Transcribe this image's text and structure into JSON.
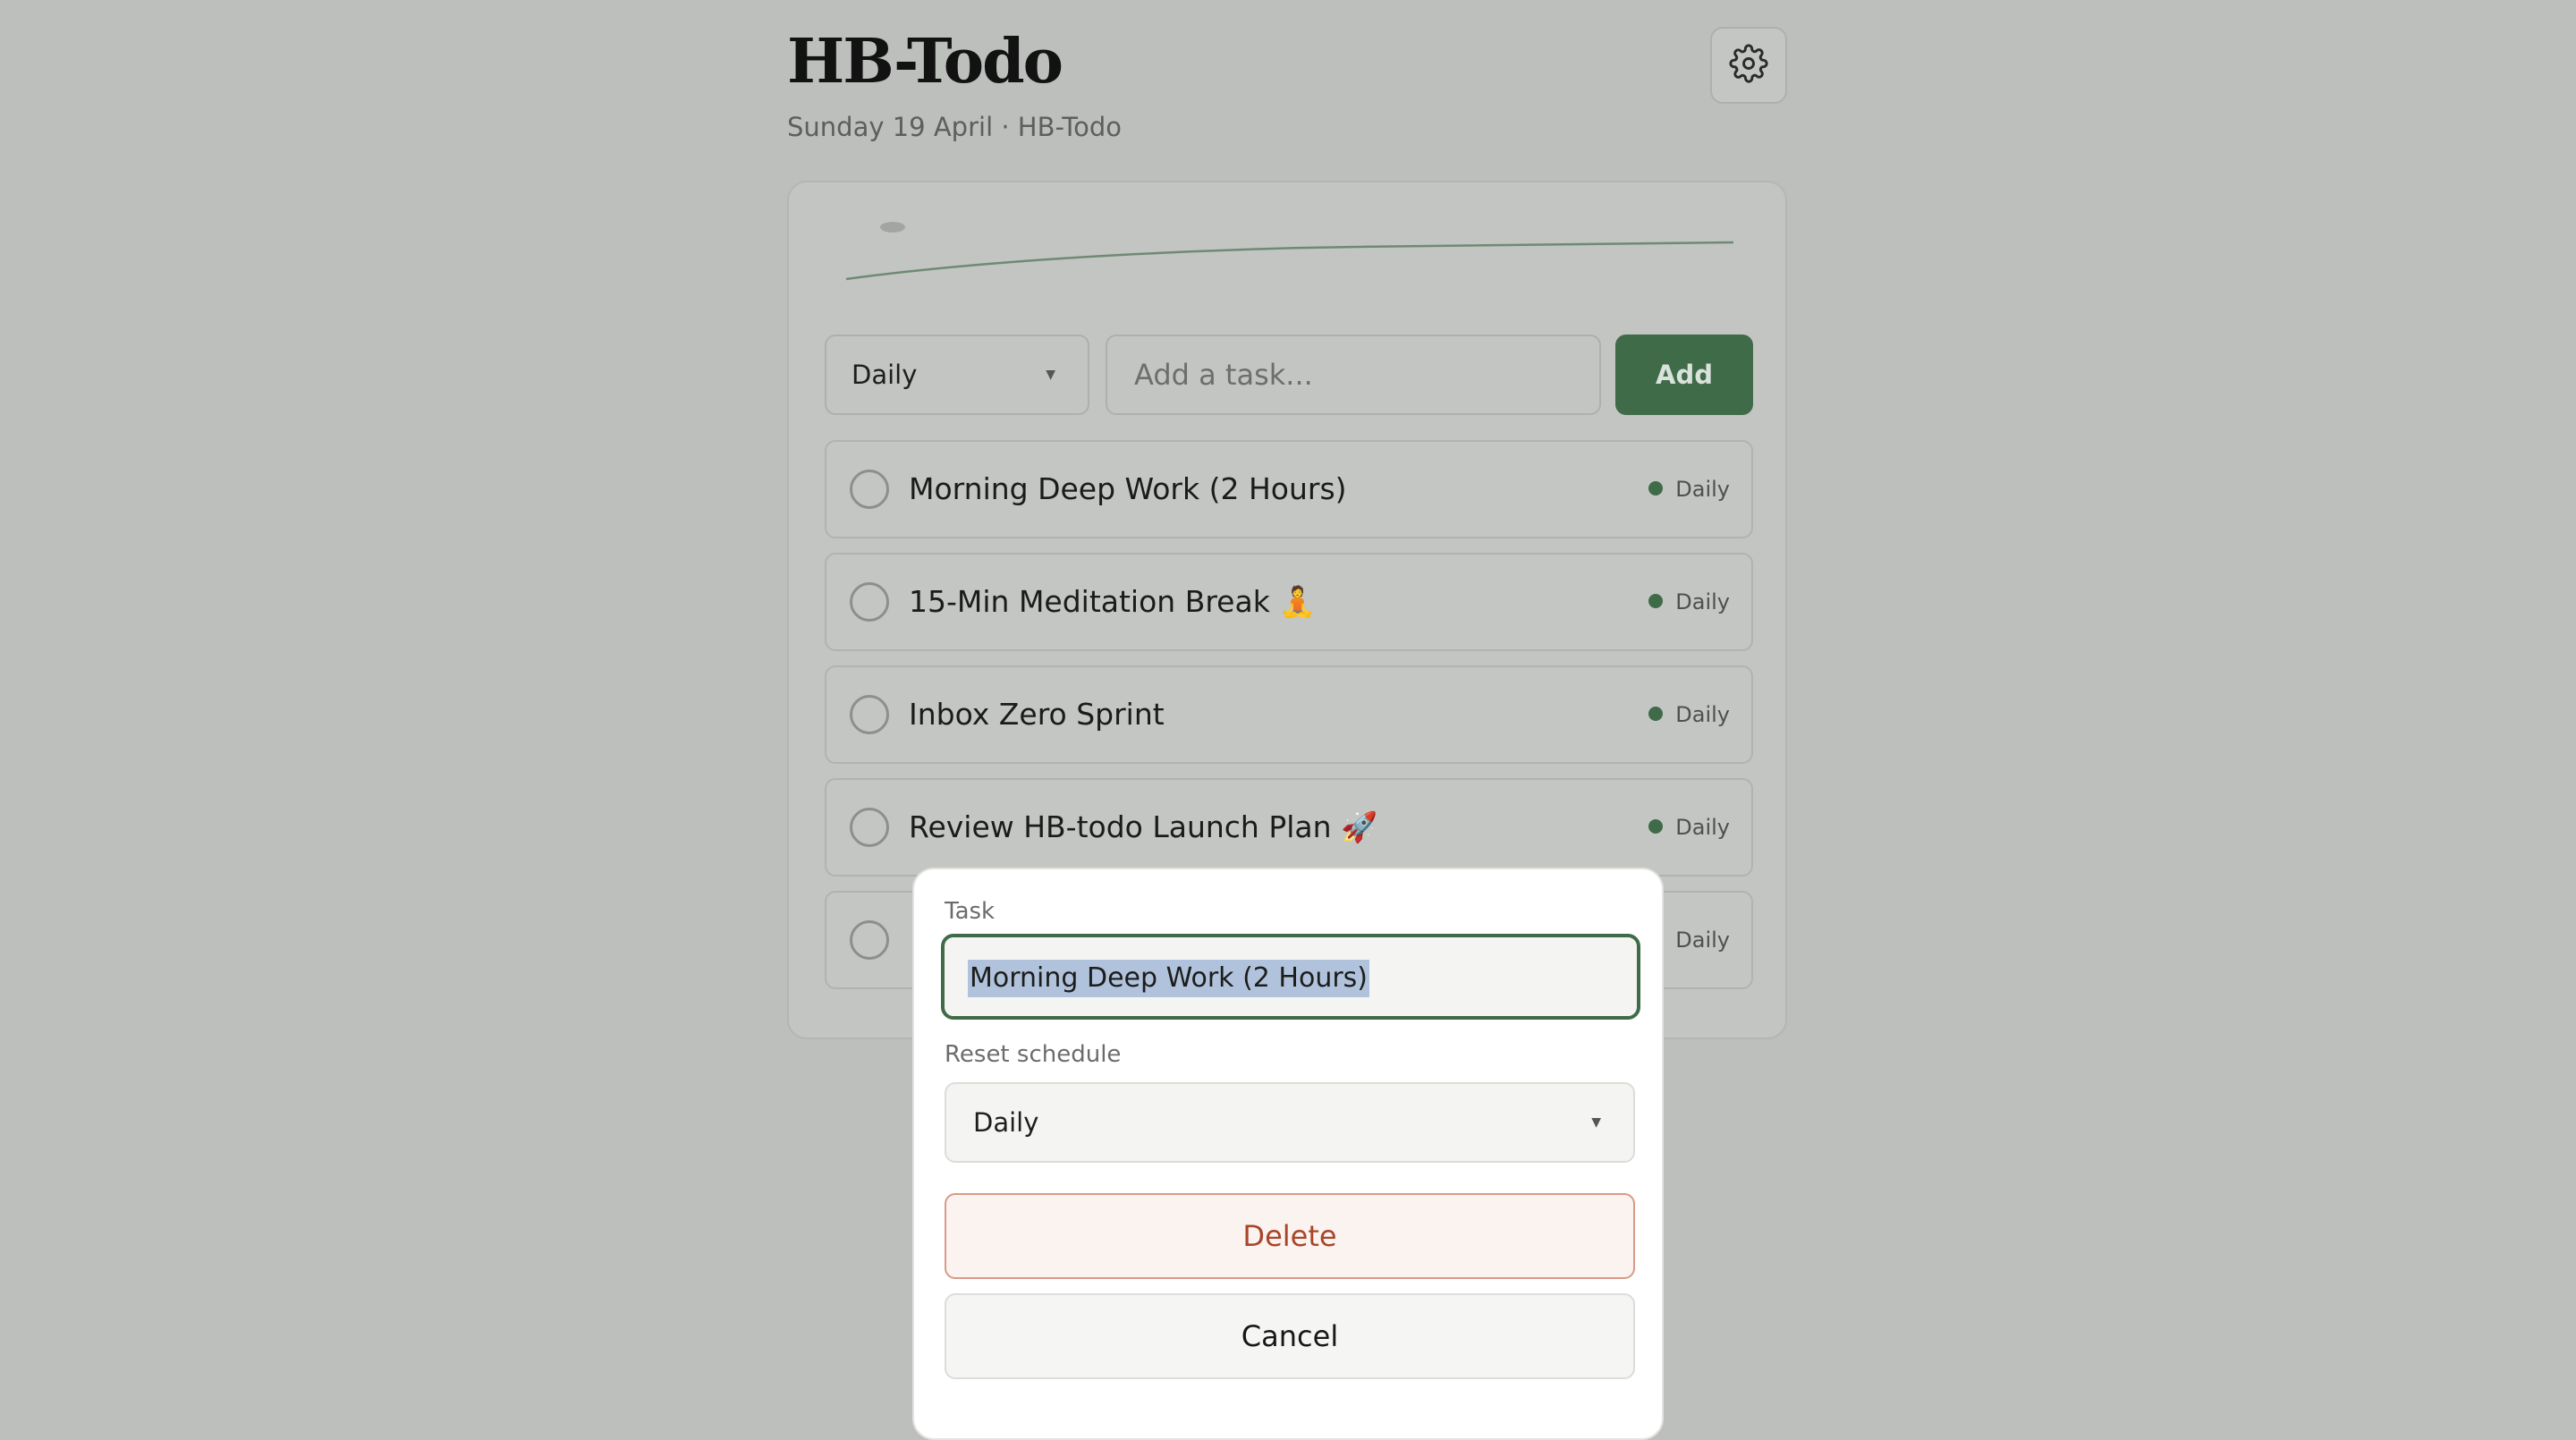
{
  "app": {
    "title": "HB-Todo",
    "subtitle": "Sunday 19 April · HB-Todo",
    "settings_icon": "gear-icon"
  },
  "composer": {
    "schedule_value": "Daily",
    "task_placeholder": "Add a task...",
    "add_label": "Add"
  },
  "tasks": [
    {
      "text": "Morning Deep Work (2 Hours)",
      "tag": "Daily"
    },
    {
      "text": "15-Min Meditation Break 🧘",
      "tag": "Daily"
    },
    {
      "text": "Inbox Zero Sprint",
      "tag": "Daily"
    },
    {
      "text": "Review HB-todo Launch Plan 🚀",
      "tag": "Daily"
    },
    {
      "text": "",
      "tag": "Daily"
    }
  ],
  "edit_dialog": {
    "task_label": "Task",
    "task_value": "Morning Deep Work (2 Hours)",
    "schedule_label": "Reset schedule",
    "schedule_value": "Daily",
    "delete_label": "Delete",
    "cancel_label": "Cancel"
  },
  "colors": {
    "accent": "#3f6b48",
    "danger": "#a9452a",
    "overlay": "#bcbfbc"
  }
}
